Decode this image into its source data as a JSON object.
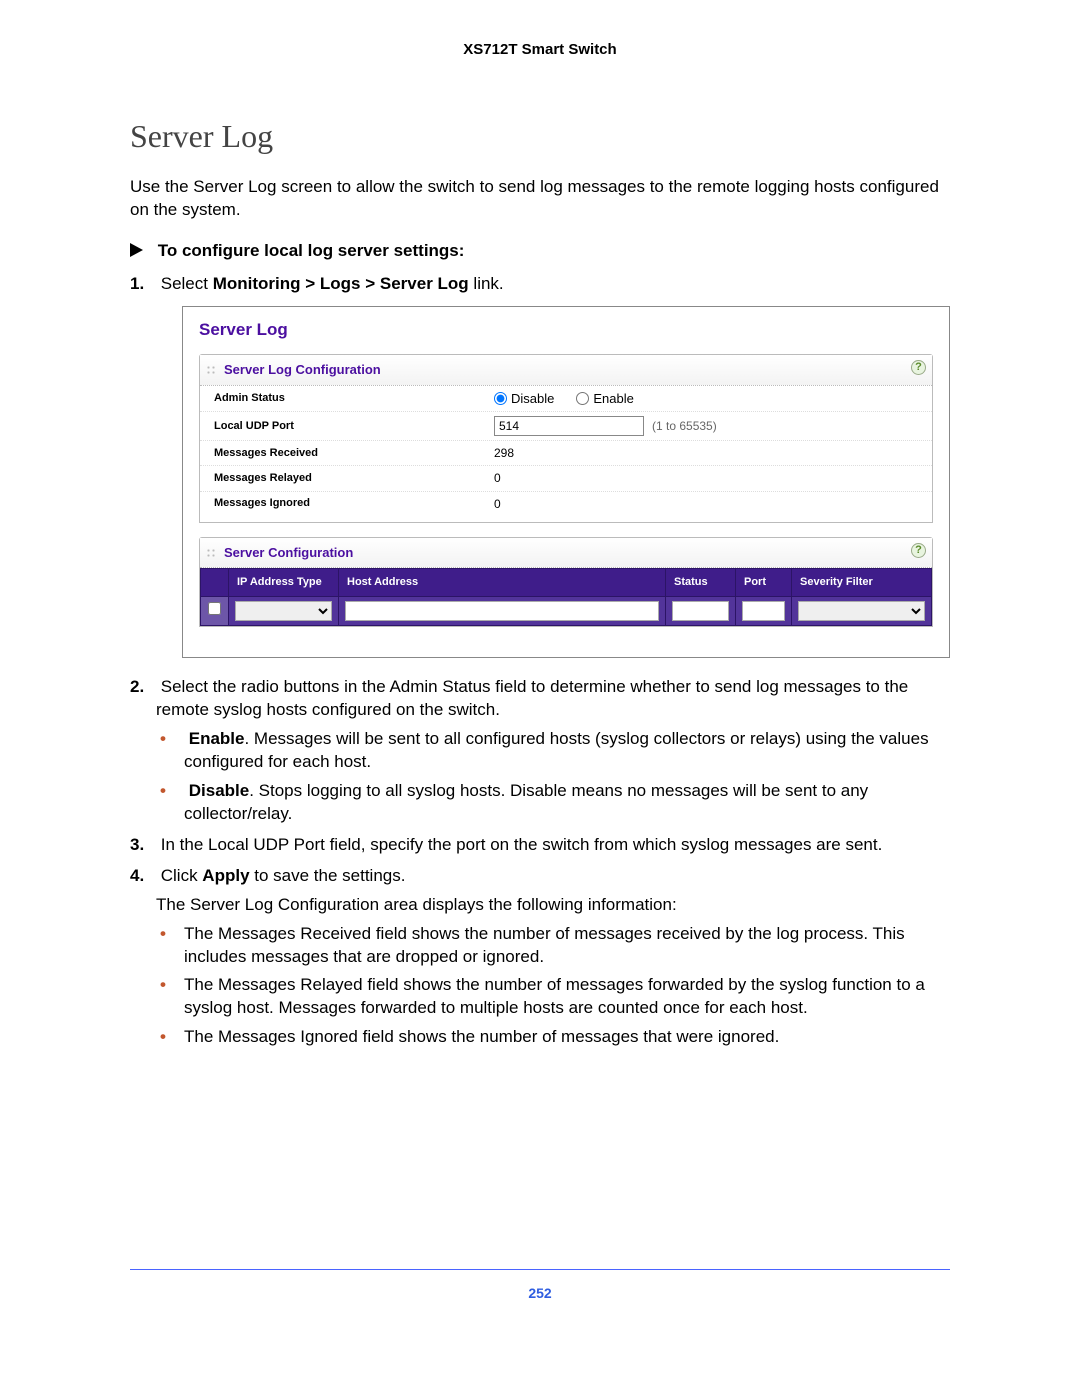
{
  "header": {
    "product": "XS712T Smart Switch"
  },
  "section": {
    "title": "Server Log",
    "intro": "Use the Server Log screen to allow the switch to send log messages to the remote logging hosts configured on the system.",
    "procedure_title": "To configure local log server settings:"
  },
  "steps": {
    "s1_prefix": "Select ",
    "s1_bold": "Monitoring > Logs > Server Log",
    "s1_suffix": " link.",
    "s2": "Select the radio buttons in the Admin Status field to determine whether to send log messages to the remote syslog hosts configured on the switch.",
    "s2_enable_b": "Enable",
    "s2_enable": ". Messages will be sent to all configured hosts (syslog collectors or relays) using the values configured for each host.",
    "s2_disable_b": "Disable",
    "s2_disable": ". Stops logging to all syslog hosts. Disable means no messages will be sent to any collector/relay.",
    "s3": "In the Local UDP Port field, specify the port on the switch from which syslog messages are sent.",
    "s4_prefix": "Click ",
    "s4_bold": "Apply",
    "s4_suffix": " to save the settings.",
    "s4_after": "The Server Log Configuration area displays the following information:",
    "s4_b1": "The Messages Received field shows the number of messages received by the log process. This includes messages that are dropped or ignored.",
    "s4_b2": "The Messages Relayed field shows the number of messages forwarded by the syslog function to a syslog host. Messages forwarded to multiple hosts are counted once for each host.",
    "s4_b3": "The Messages Ignored field shows the number of messages that were ignored."
  },
  "screenshot": {
    "panel_title": "Server Log",
    "sec1_title": "Server Log Configuration",
    "sec2_title": "Server Configuration",
    "labels": {
      "admin_status": "Admin Status",
      "disable": "Disable",
      "enable": "Enable",
      "local_udp": "Local UDP Port",
      "udp_hint": "(1 to 65535)",
      "udp_val": "514",
      "msgs_rx": "Messages Received",
      "msgs_rx_v": "298",
      "msgs_relay": "Messages Relayed",
      "msgs_relay_v": "0",
      "msgs_ign": "Messages Ignored",
      "msgs_ign_v": "0"
    },
    "table_headers": {
      "ip_type": "IP Address Type",
      "host": "Host Address",
      "status": "Status",
      "port": "Port",
      "severity": "Severity Filter"
    }
  },
  "page_number": "252"
}
